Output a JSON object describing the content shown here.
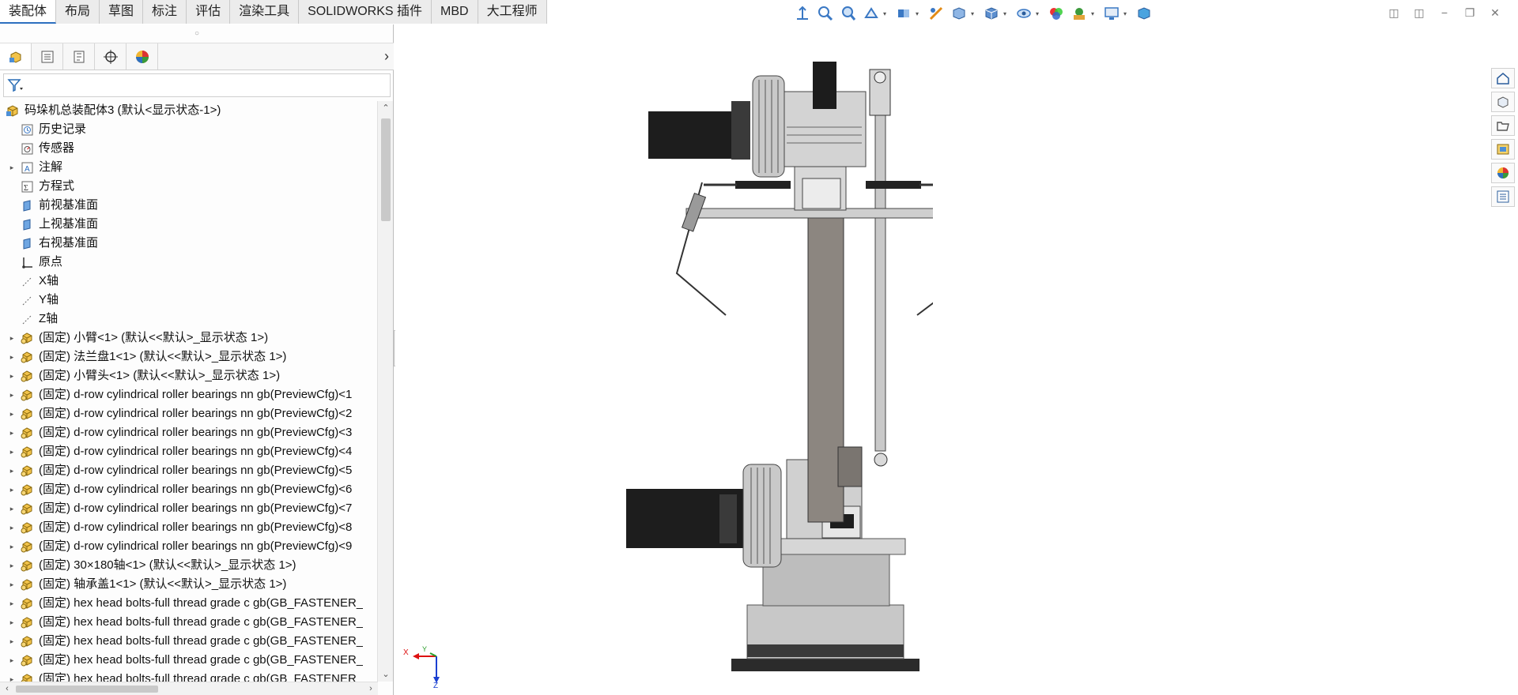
{
  "tabs": [
    "装配体",
    "布局",
    "草图",
    "标注",
    "评估",
    "渲染工具",
    "SOLIDWORKS 插件",
    "MBD",
    "大工程师"
  ],
  "active_tab_index": 0,
  "hud_icons": [
    "view-normal-to-icon",
    "zoom-to-fit-icon",
    "zoom-to-area-icon",
    "previous-view-icon",
    "section-view-icon",
    "dynamic-annotation-icon",
    "view-orientation-icon",
    "display-style-icon",
    "hide-show-icon",
    "edit-appearance-icon",
    "apply-scene-icon",
    "view-settings-icon",
    "realview-icon"
  ],
  "window_controls": [
    "tile-left-icon",
    "tile-right-icon",
    "minimize-icon",
    "restore-icon",
    "close-icon"
  ],
  "feature_manager_tabs": [
    "featuremanager-tree-icon",
    "propertymanager-icon",
    "configurationmanager-icon",
    "dimxpertmanager-icon",
    "displaymanager-icon"
  ],
  "tree": {
    "root": "码垛机总装配体3  (默认<显示状态-1>)",
    "items": [
      {
        "label": "历史记录",
        "icon": "history",
        "expandable": false,
        "indent": 1
      },
      {
        "label": "传感器",
        "icon": "sensor",
        "expandable": false,
        "indent": 1
      },
      {
        "label": "注解",
        "icon": "annotation",
        "expandable": true,
        "indent": 1
      },
      {
        "label": "方程式",
        "icon": "equation",
        "expandable": false,
        "indent": 1
      },
      {
        "label": "前视基准面",
        "icon": "plane",
        "expandable": false,
        "indent": 1
      },
      {
        "label": "上视基准面",
        "icon": "plane",
        "expandable": false,
        "indent": 1
      },
      {
        "label": "右视基准面",
        "icon": "plane",
        "expandable": false,
        "indent": 1
      },
      {
        "label": "原点",
        "icon": "origin",
        "expandable": false,
        "indent": 1
      },
      {
        "label": "X轴",
        "icon": "axis",
        "expandable": false,
        "indent": 1
      },
      {
        "label": "Y轴",
        "icon": "axis",
        "expandable": false,
        "indent": 1
      },
      {
        "label": "Z轴",
        "icon": "axis",
        "expandable": false,
        "indent": 1
      },
      {
        "label": "(固定) 小臂<1> (默认<<默认>_显示状态 1>)",
        "icon": "assembly",
        "expandable": true,
        "indent": 1
      },
      {
        "label": "(固定) 法兰盘1<1> (默认<<默认>_显示状态 1>)",
        "icon": "assembly",
        "expandable": true,
        "indent": 1
      },
      {
        "label": "(固定) 小臂头<1> (默认<<默认>_显示状态 1>)",
        "icon": "assembly",
        "expandable": true,
        "indent": 1
      },
      {
        "label": "(固定) d-row cylindrical roller bearings nn gb(PreviewCfg)<1",
        "icon": "assembly",
        "expandable": true,
        "indent": 1
      },
      {
        "label": "(固定) d-row cylindrical roller bearings nn gb(PreviewCfg)<2",
        "icon": "assembly",
        "expandable": true,
        "indent": 1
      },
      {
        "label": "(固定) d-row cylindrical roller bearings nn gb(PreviewCfg)<3",
        "icon": "assembly",
        "expandable": true,
        "indent": 1
      },
      {
        "label": "(固定) d-row cylindrical roller bearings nn gb(PreviewCfg)<4",
        "icon": "assembly",
        "expandable": true,
        "indent": 1
      },
      {
        "label": "(固定) d-row cylindrical roller bearings nn gb(PreviewCfg)<5",
        "icon": "assembly",
        "expandable": true,
        "indent": 1
      },
      {
        "label": "(固定) d-row cylindrical roller bearings nn gb(PreviewCfg)<6",
        "icon": "assembly",
        "expandable": true,
        "indent": 1
      },
      {
        "label": "(固定) d-row cylindrical roller bearings nn gb(PreviewCfg)<7",
        "icon": "assembly",
        "expandable": true,
        "indent": 1
      },
      {
        "label": "(固定) d-row cylindrical roller bearings nn gb(PreviewCfg)<8",
        "icon": "assembly",
        "expandable": true,
        "indent": 1
      },
      {
        "label": "(固定) d-row cylindrical roller bearings nn gb(PreviewCfg)<9",
        "icon": "assembly",
        "expandable": true,
        "indent": 1
      },
      {
        "label": "(固定) 30×180轴<1> (默认<<默认>_显示状态 1>)",
        "icon": "assembly",
        "expandable": true,
        "indent": 1
      },
      {
        "label": "(固定) 轴承盖1<1> (默认<<默认>_显示状态 1>)",
        "icon": "assembly",
        "expandable": true,
        "indent": 1
      },
      {
        "label": "(固定) hex head bolts-full thread grade c gb(GB_FASTENER_",
        "icon": "assembly",
        "expandable": true,
        "indent": 1
      },
      {
        "label": "(固定) hex head bolts-full thread grade c gb(GB_FASTENER_",
        "icon": "assembly",
        "expandable": true,
        "indent": 1
      },
      {
        "label": "(固定) hex head bolts-full thread grade c gb(GB_FASTENER_",
        "icon": "assembly",
        "expandable": true,
        "indent": 1
      },
      {
        "label": "(固定) hex head bolts-full thread grade c gb(GB_FASTENER_",
        "icon": "assembly",
        "expandable": true,
        "indent": 1
      },
      {
        "label": "(固定) hex head bolts-full thread grade c gb(GB_FASTENER_",
        "icon": "assembly",
        "expandable": true,
        "indent": 1
      }
    ]
  },
  "triad": {
    "x_label": "X",
    "y_label": "Y",
    "z_label": "Z"
  },
  "task_pane": [
    "solidworks-resources-icon",
    "design-library-icon",
    "file-explorer-icon",
    "view-palette-icon",
    "appearances-icon",
    "custom-properties-icon"
  ],
  "colors": {
    "accent": "#2c6fbf",
    "tree_bg": "#fdfdfd",
    "model_gray": "#b9b9b9",
    "model_dark": "#222222",
    "arm": "#8c8680"
  }
}
